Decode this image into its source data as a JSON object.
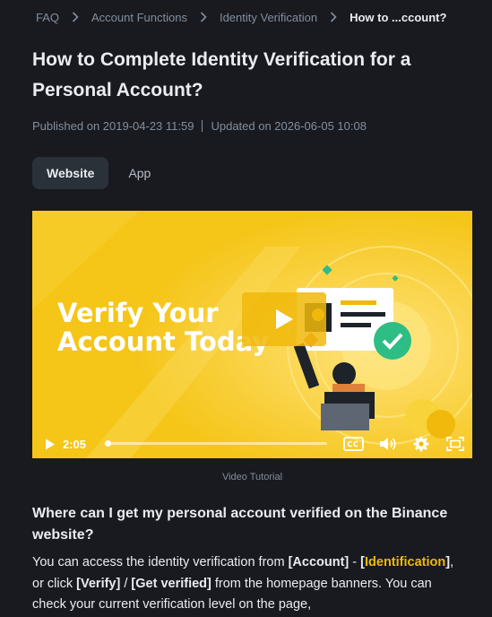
{
  "breadcrumb": {
    "items": [
      "FAQ",
      "Account Functions",
      "Identity Verification"
    ],
    "current": "How to ...ccount?"
  },
  "article": {
    "title": "How to Complete Identity Verification for a Personal Account?",
    "published": "Published on 2019-04-23 11:59",
    "updated": "Updated on 2026-06-05 10:08"
  },
  "tabs": [
    {
      "label": "Website",
      "active": true
    },
    {
      "label": "App",
      "active": false
    }
  ],
  "video": {
    "headline_line1": "Verify Your",
    "headline_line2": "Account Today",
    "time": "2:05",
    "progress_fraction": 0.0,
    "caption": "Video Tutorial",
    "icons": [
      "play-icon",
      "closed-captions-icon",
      "volume-icon",
      "settings-icon",
      "fullscreen-icon"
    ]
  },
  "section": {
    "heading": "Where can I get my personal account verified on the Binance website?",
    "para_1": "You can access the identity verification from ",
    "account": "[Account]",
    "para_2": " - ",
    "identification_open": "[",
    "identification": "Identification",
    "identification_close": "]",
    "para_3": ", or click ",
    "verify": "[Verify]",
    "para_4": " / ",
    "get_verified": "[Get verified]",
    "para_5": " from the homepage banners. You can check your current verification level on the page,"
  },
  "colors": {
    "background": "#181a20",
    "accent": "#f0b90b",
    "muted_text": "#848e9c",
    "active_tab": "#2b3139"
  }
}
